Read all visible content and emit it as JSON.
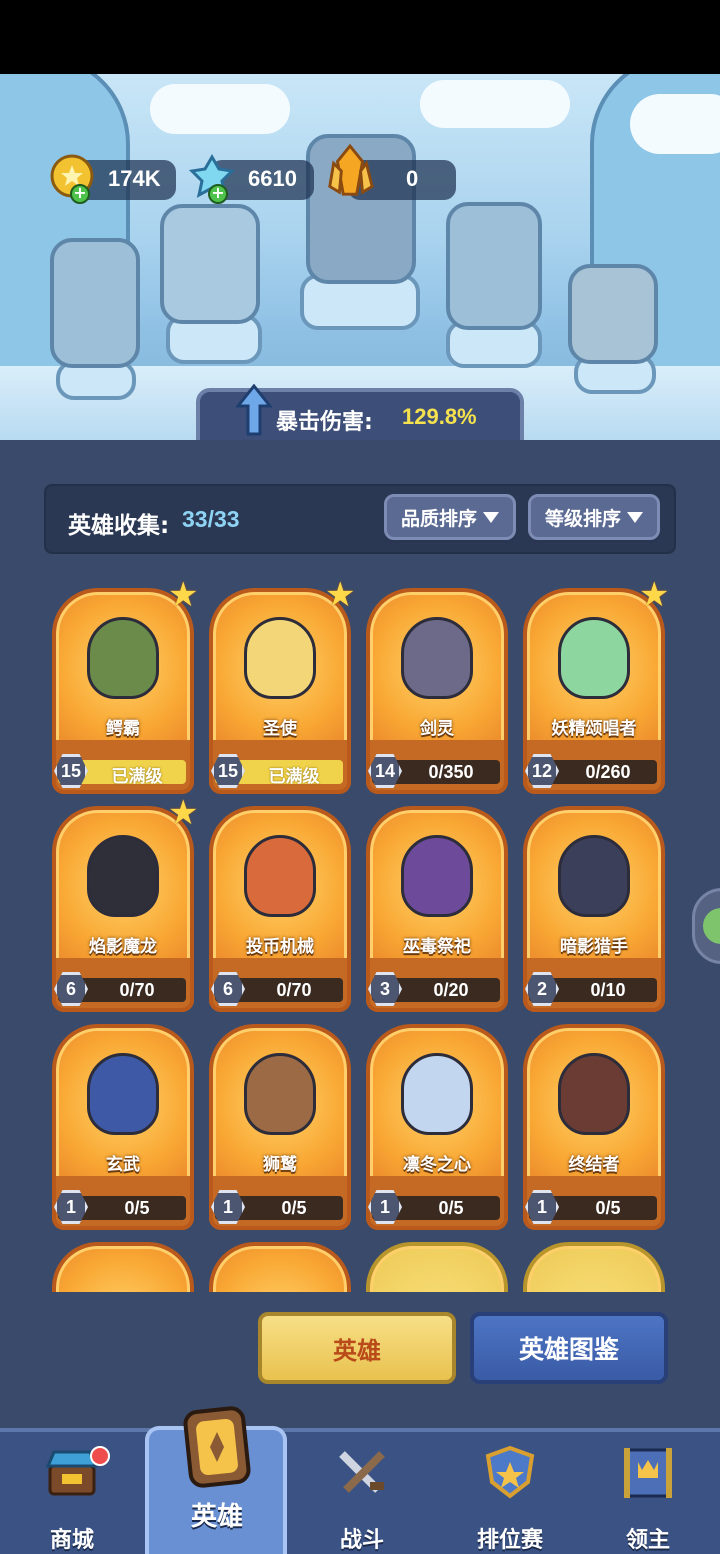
{
  "currency": {
    "gold": "174K",
    "gems": "6610",
    "crystals": "0"
  },
  "banner": {
    "label": "暴击伤害:",
    "value": "129.8%"
  },
  "collection": {
    "label": "英雄收集:",
    "count": "33/33"
  },
  "sort": {
    "quality": "品质排序",
    "level": "等级排序"
  },
  "heroes": [
    {
      "name": "鳄霸",
      "level": "15",
      "progress": "已满级",
      "maxed": true,
      "star": true,
      "color": "#6b8b4a"
    },
    {
      "name": "圣使",
      "level": "15",
      "progress": "已满级",
      "maxed": true,
      "star": true,
      "color": "#f2d678"
    },
    {
      "name": "剑灵",
      "level": "14",
      "progress": "0/350",
      "maxed": false,
      "star": false,
      "color": "#6c6a88"
    },
    {
      "name": "妖精颂唱者",
      "level": "12",
      "progress": "0/260",
      "maxed": false,
      "star": true,
      "color": "#8ed6a0"
    },
    {
      "name": "焰影魔龙",
      "level": "6",
      "progress": "0/70",
      "maxed": false,
      "star": true,
      "color": "#2f2f3a"
    },
    {
      "name": "投币机械",
      "level": "6",
      "progress": "0/70",
      "maxed": false,
      "star": false,
      "color": "#d86a3c"
    },
    {
      "name": "巫毒祭祀",
      "level": "3",
      "progress": "0/20",
      "maxed": false,
      "star": false,
      "color": "#6d4a9a"
    },
    {
      "name": "暗影猎手",
      "level": "2",
      "progress": "0/10",
      "maxed": false,
      "star": false,
      "color": "#3c3f5a"
    },
    {
      "name": "玄武",
      "level": "1",
      "progress": "0/5",
      "maxed": false,
      "star": false,
      "color": "#3e5aa6"
    },
    {
      "name": "狮鹫",
      "level": "1",
      "progress": "0/5",
      "maxed": false,
      "star": false,
      "color": "#9c6a44"
    },
    {
      "name": "凛冬之心",
      "level": "1",
      "progress": "0/5",
      "maxed": false,
      "star": false,
      "color": "#c2d6f0"
    },
    {
      "name": "终结者",
      "level": "1",
      "progress": "0/5",
      "maxed": false,
      "star": false,
      "color": "#6a3c34"
    }
  ],
  "buttons": {
    "hero": "英雄",
    "codex": "英雄图鉴"
  },
  "nav": {
    "shop": "商城",
    "hero": "英雄",
    "battle": "战斗",
    "ranked": "排位赛",
    "lord": "领主"
  },
  "icons": {
    "gold": "gold-coin-icon",
    "gems": "blue-gem-icon",
    "crystals": "orange-crystal-icon",
    "chat": "chat-icon"
  }
}
